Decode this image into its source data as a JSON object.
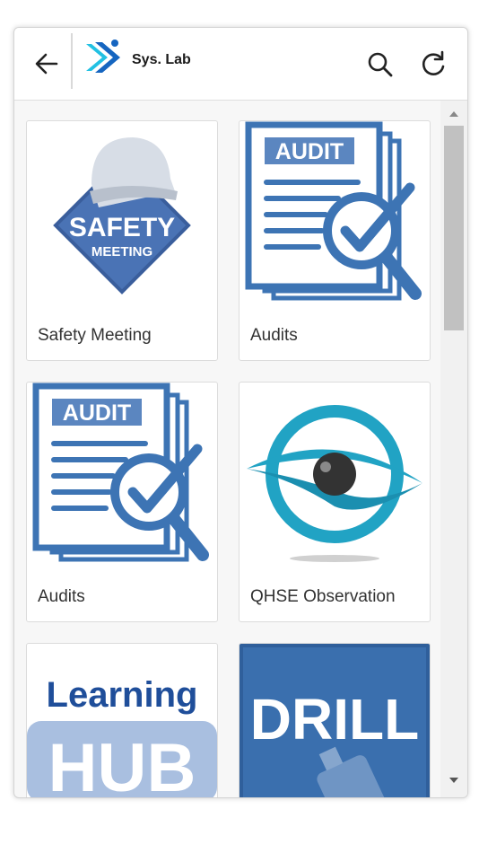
{
  "header": {
    "brand": "Sys. Lab",
    "back_icon": "arrow-left-icon",
    "search_icon": "search-icon",
    "refresh_icon": "refresh-icon"
  },
  "cards": [
    {
      "label": "Safety Meeting",
      "icon": "safety-meeting-badge",
      "image_text": [
        "SAFETY",
        "MEETING"
      ]
    },
    {
      "label": "Audits",
      "icon": "audit-document-icon",
      "image_text": [
        "AUDIT"
      ]
    },
    {
      "label": "Audits",
      "icon": "audit-document-icon",
      "image_text": [
        "AUDIT"
      ]
    },
    {
      "label": "QHSE Observation",
      "icon": "eye-observation-icon"
    },
    {
      "label": "",
      "icon": "learning-hub-logo",
      "image_text": [
        "Learning",
        "HUB"
      ]
    },
    {
      "label": "",
      "icon": "drill-image",
      "image_text": [
        "DRILL"
      ]
    }
  ],
  "colors": {
    "accent_blue": "#3d74b4",
    "teal": "#21a3c4",
    "logo_blue": "#1689d6"
  }
}
